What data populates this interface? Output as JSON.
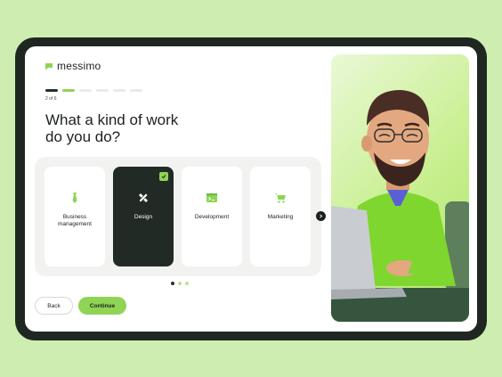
{
  "brand": {
    "name": "messimo",
    "accent": "#8fd454",
    "dark": "#222a25"
  },
  "progress": {
    "current": 2,
    "total": 6,
    "label": "2 of 6"
  },
  "question": {
    "line1": "What a kind of work",
    "line2": "do you do?"
  },
  "cards": [
    {
      "label_line1": "Business",
      "label_line2": "management",
      "icon": "tie-icon",
      "selected": false
    },
    {
      "label_line1": "Design",
      "label_line2": "",
      "icon": "ruler-pencil-icon",
      "selected": true
    },
    {
      "label_line1": "Development",
      "label_line2": "",
      "icon": "code-window-icon",
      "selected": false
    },
    {
      "label_line1": "Marketing",
      "label_line2": "",
      "icon": "cart-icon",
      "selected": false
    }
  ],
  "pagination": {
    "pages": 3,
    "active": 1
  },
  "buttons": {
    "back": "Back",
    "continue": "Continue"
  }
}
